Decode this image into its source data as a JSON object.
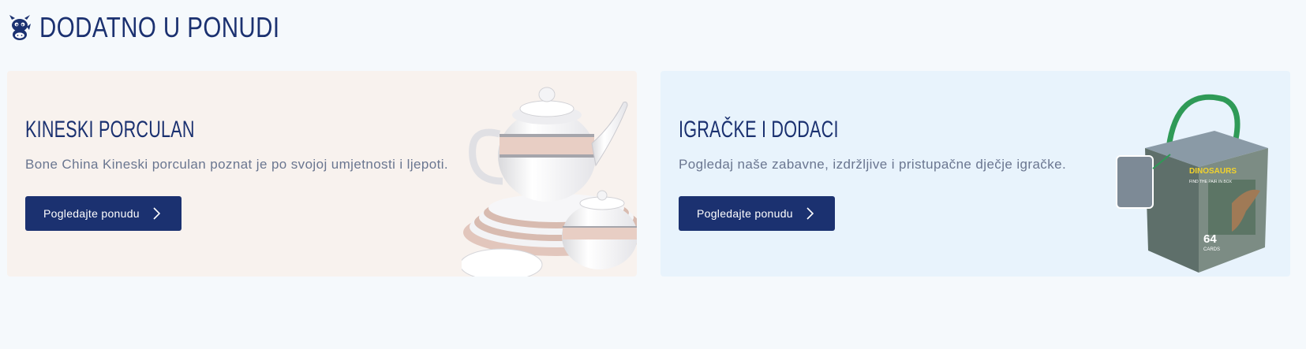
{
  "section": {
    "title": "DODATNO U PONUDI",
    "icon": "cow-mascot-icon"
  },
  "cards": [
    {
      "title": "KINESKI PORCULAN",
      "description": "Bone China Kineski porculan poznat je po svojoj umjetnosti i ljepoti.",
      "button_label": "Pogledajte ponudu",
      "background": "#f8f2ee",
      "image": "porcelain-tea-set-image"
    },
    {
      "title": "IGRAČKE I DODACI",
      "description": "Pogledaj naše zabavne, izdržljive i pristupačne dječje igračke.",
      "button_label": "Pogledajte ponudu",
      "background": "#e8f3fc",
      "image": "dinosaur-card-game-box-image",
      "box_brand": "DINOSAURS",
      "box_tagline": "FIND THE PAIR IN BOX",
      "box_count": "64",
      "box_count_unit": "CARDS"
    }
  ],
  "colors": {
    "primary": "#1b3170",
    "text_muted": "#6a7690",
    "page_background": "#f5f9fc"
  }
}
